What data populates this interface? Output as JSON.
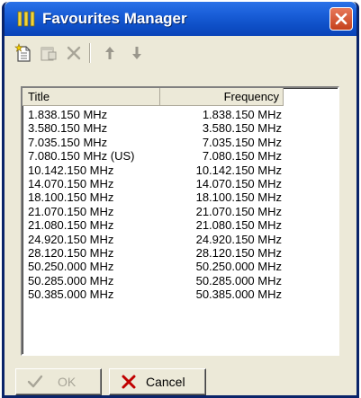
{
  "window": {
    "title": "Favourites Manager"
  },
  "toolbar": {
    "items": [
      {
        "icon": "new-favourite-icon",
        "enabled": true
      },
      {
        "icon": "properties-icon",
        "enabled": false
      },
      {
        "icon": "delete-icon",
        "enabled": false
      },
      {
        "icon": "move-up-icon",
        "enabled": false
      },
      {
        "icon": "move-down-icon",
        "enabled": false
      }
    ]
  },
  "list": {
    "columns": [
      "Title",
      "Frequency"
    ],
    "rows": [
      {
        "title": "1.838.150 MHz",
        "frequency": "1.838.150 MHz"
      },
      {
        "title": "3.580.150 MHz",
        "frequency": "3.580.150 MHz"
      },
      {
        "title": "7.035.150 MHz",
        "frequency": "7.035.150 MHz"
      },
      {
        "title": "7.080.150 MHz (US)",
        "frequency": "7.080.150 MHz"
      },
      {
        "title": "10.142.150 MHz",
        "frequency": "10.142.150 MHz"
      },
      {
        "title": "14.070.150 MHz",
        "frequency": "14.070.150 MHz"
      },
      {
        "title": "18.100.150 MHz",
        "frequency": "18.100.150 MHz"
      },
      {
        "title": "21.070.150 MHz",
        "frequency": "21.070.150 MHz"
      },
      {
        "title": "21.080.150 MHz",
        "frequency": "21.080.150 MHz"
      },
      {
        "title": "24.920.150 MHz",
        "frequency": "24.920.150 MHz"
      },
      {
        "title": "28.120.150 MHz",
        "frequency": "28.120.150 MHz"
      },
      {
        "title": "50.250.000 MHz",
        "frequency": "50.250.000 MHz"
      },
      {
        "title": "50.285.000 MHz",
        "frequency": "50.285.000 MHz"
      },
      {
        "title": "50.385.000 MHz",
        "frequency": "50.385.000 MHz"
      }
    ]
  },
  "buttons": {
    "ok_label": "OK",
    "cancel_label": "Cancel"
  },
  "colors": {
    "titlebar": "#1a5fd9",
    "close_button": "#c5401c",
    "dialog_bg": "#ece9d8",
    "disabled_text": "#a8a598"
  }
}
